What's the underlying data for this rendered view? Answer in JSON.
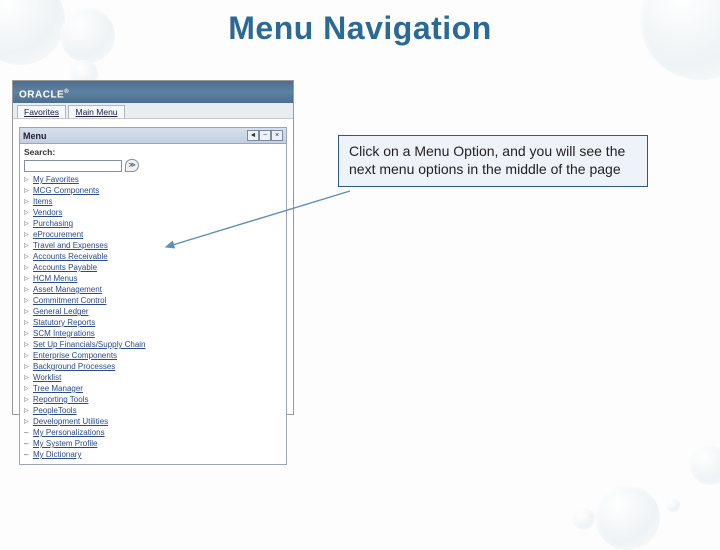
{
  "slide": {
    "title": "Menu Navigation"
  },
  "callout": {
    "text": "Click on a Menu Option, and you will see the next menu options in the middle of the page"
  },
  "app": {
    "brand": "ORACLE",
    "tabs": {
      "favorites": "Favorites",
      "main": "Main Menu"
    },
    "panel": {
      "title": "Menu",
      "controls": {
        "left": "◄",
        "minus": "−",
        "close": "×"
      },
      "search_label": "Search:",
      "search_value": "",
      "go_glyph": "≫"
    },
    "menu_items": [
      {
        "label": "My Favorites",
        "expandable": true
      },
      {
        "label": "MCG Components",
        "expandable": true
      },
      {
        "label": "Items",
        "expandable": true
      },
      {
        "label": "Vendors",
        "expandable": true
      },
      {
        "label": "Purchasing",
        "expandable": true
      },
      {
        "label": "eProcurement",
        "expandable": true
      },
      {
        "label": "Travel and Expenses",
        "expandable": true
      },
      {
        "label": "Accounts Receivable",
        "expandable": true
      },
      {
        "label": "Accounts Payable",
        "expandable": true
      },
      {
        "label": "HCM Menus",
        "expandable": true
      },
      {
        "label": "Asset Management",
        "expandable": true
      },
      {
        "label": "Commitment Control",
        "expandable": true
      },
      {
        "label": "General Ledger",
        "expandable": true
      },
      {
        "label": "Statutory Reports",
        "expandable": true
      },
      {
        "label": "SCM Integrations",
        "expandable": true
      },
      {
        "label": "Set Up Financials/Supply Chain",
        "expandable": true
      },
      {
        "label": "Enterprise Components",
        "expandable": true
      },
      {
        "label": "Background Processes",
        "expandable": true
      },
      {
        "label": "Worklist",
        "expandable": true
      },
      {
        "label": "Tree Manager",
        "expandable": true
      },
      {
        "label": "Reporting Tools",
        "expandable": true
      },
      {
        "label": "PeopleTools",
        "expandable": true
      },
      {
        "label": "Development Utilities",
        "expandable": true
      },
      {
        "label": "My Personalizations",
        "expandable": false
      },
      {
        "label": "My System Profile",
        "expandable": false
      },
      {
        "label": "My Dictionary",
        "expandable": false
      }
    ]
  }
}
